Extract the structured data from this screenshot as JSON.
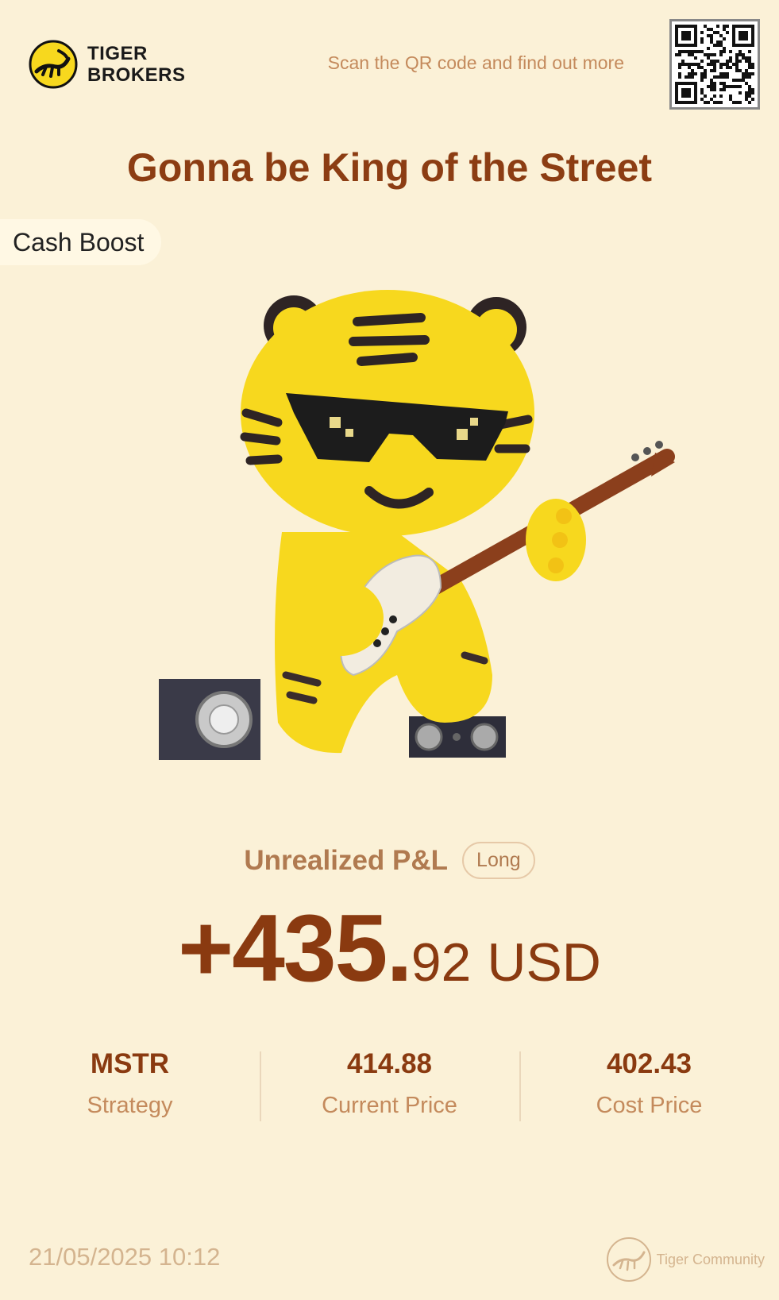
{
  "header": {
    "brand_line1": "TIGER",
    "brand_line2": "BROKERS",
    "scan_text": "Scan the QR code and find out more"
  },
  "headline": "Gonna be King of the Street",
  "badge": "Cash Boost",
  "pnl": {
    "label": "Unrealized P&L",
    "position": "Long",
    "amount_int": "+435.",
    "amount_dec": "92",
    "currency": "USD"
  },
  "stats": [
    {
      "value": "MSTR",
      "label": "Strategy"
    },
    {
      "value": "414.88",
      "label": "Current Price"
    },
    {
      "value": "402.43",
      "label": "Cost Price"
    }
  ],
  "footer": {
    "timestamp": "21/05/2025 10:12",
    "community": "Tiger Community"
  },
  "colors": {
    "background": "#fbf1d7",
    "accent": "#8a3a10",
    "muted": "#c48a5c",
    "mascot_yellow": "#f7d81e"
  },
  "icons": {
    "logo": "tiger-logo-icon",
    "qr": "qr-code-icon",
    "community": "tiger-community-icon"
  }
}
